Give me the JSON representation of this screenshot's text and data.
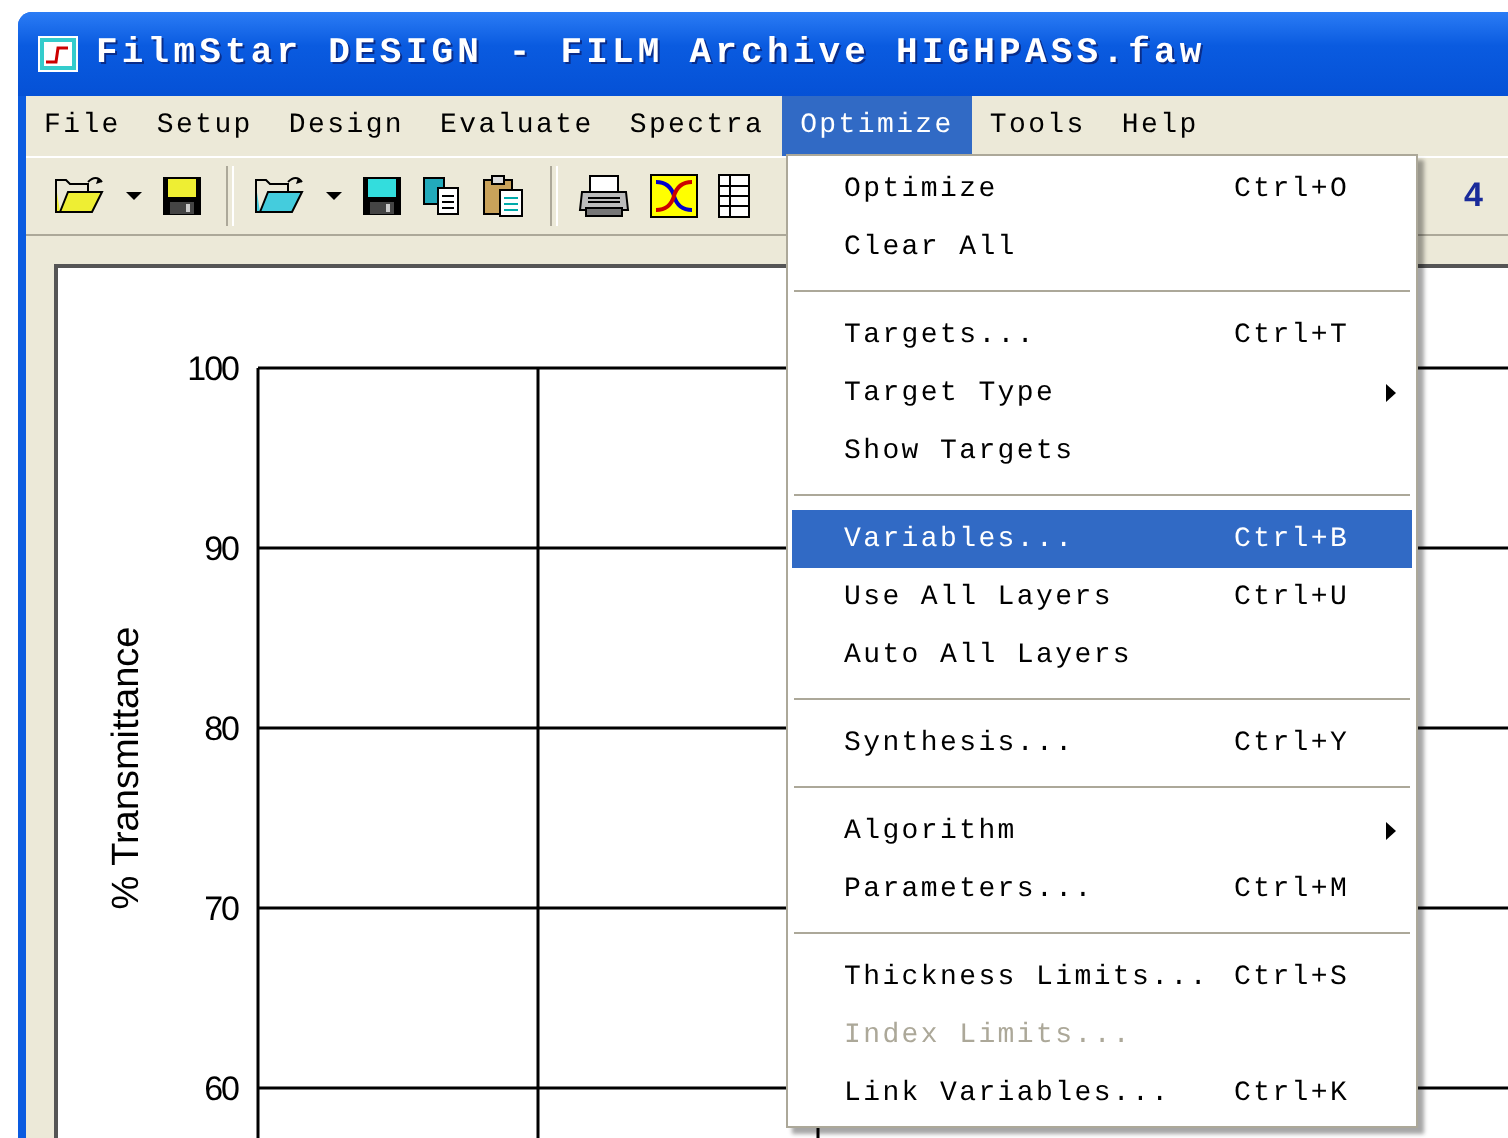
{
  "window": {
    "title": "FilmStar DESIGN - FILM Archive HIGHPASS.faw"
  },
  "menu_bar": [
    {
      "label": "File",
      "selected": false
    },
    {
      "label": "Setup",
      "selected": false
    },
    {
      "label": "Design",
      "selected": false
    },
    {
      "label": "Evaluate",
      "selected": false
    },
    {
      "label": "Spectra",
      "selected": false
    },
    {
      "label": "Optimize",
      "selected": true
    },
    {
      "label": "Tools",
      "selected": false
    },
    {
      "label": "Help",
      "selected": false
    }
  ],
  "toolbar": {
    "trailing_text": "4"
  },
  "open_menu": {
    "items": [
      {
        "kind": "item",
        "label": "Optimize",
        "shortcut": "Ctrl+O",
        "selected": false,
        "disabled": false
      },
      {
        "kind": "item",
        "label": "Clear All",
        "selected": false,
        "disabled": false
      },
      {
        "kind": "separator"
      },
      {
        "kind": "item",
        "label": "Targets...",
        "shortcut": "Ctrl+T",
        "selected": false,
        "disabled": false
      },
      {
        "kind": "submenu",
        "label": "Target Type",
        "selected": false,
        "disabled": false
      },
      {
        "kind": "item",
        "label": "Show Targets",
        "selected": false,
        "disabled": false
      },
      {
        "kind": "separator"
      },
      {
        "kind": "item",
        "label": "Variables...",
        "shortcut": "Ctrl+B",
        "selected": true,
        "disabled": false
      },
      {
        "kind": "item",
        "label": "Use All Layers",
        "shortcut": "Ctrl+U",
        "selected": false,
        "disabled": false
      },
      {
        "kind": "item",
        "label": "Auto All Layers",
        "selected": false,
        "disabled": false
      },
      {
        "kind": "separator"
      },
      {
        "kind": "item",
        "label": "Synthesis...",
        "shortcut": "Ctrl+Y",
        "selected": false,
        "disabled": false
      },
      {
        "kind": "separator"
      },
      {
        "kind": "submenu",
        "label": "Algorithm",
        "selected": false,
        "disabled": false
      },
      {
        "kind": "item",
        "label": "Parameters...",
        "shortcut": "Ctrl+M",
        "selected": false,
        "disabled": false
      },
      {
        "kind": "separator"
      },
      {
        "kind": "item",
        "label": "Thickness Limits...",
        "shortcut": "Ctrl+S",
        "selected": false,
        "disabled": false
      },
      {
        "kind": "item",
        "label": "Index Limits...",
        "selected": false,
        "disabled": true
      },
      {
        "kind": "item",
        "label": "Link Variables...",
        "shortcut": "Ctrl+K",
        "selected": false,
        "disabled": false
      }
    ]
  },
  "plot": {
    "y_axis_title": "% Transmittance",
    "y_tick_labels": [
      "100",
      "90",
      "80",
      "70",
      "60"
    ]
  }
}
